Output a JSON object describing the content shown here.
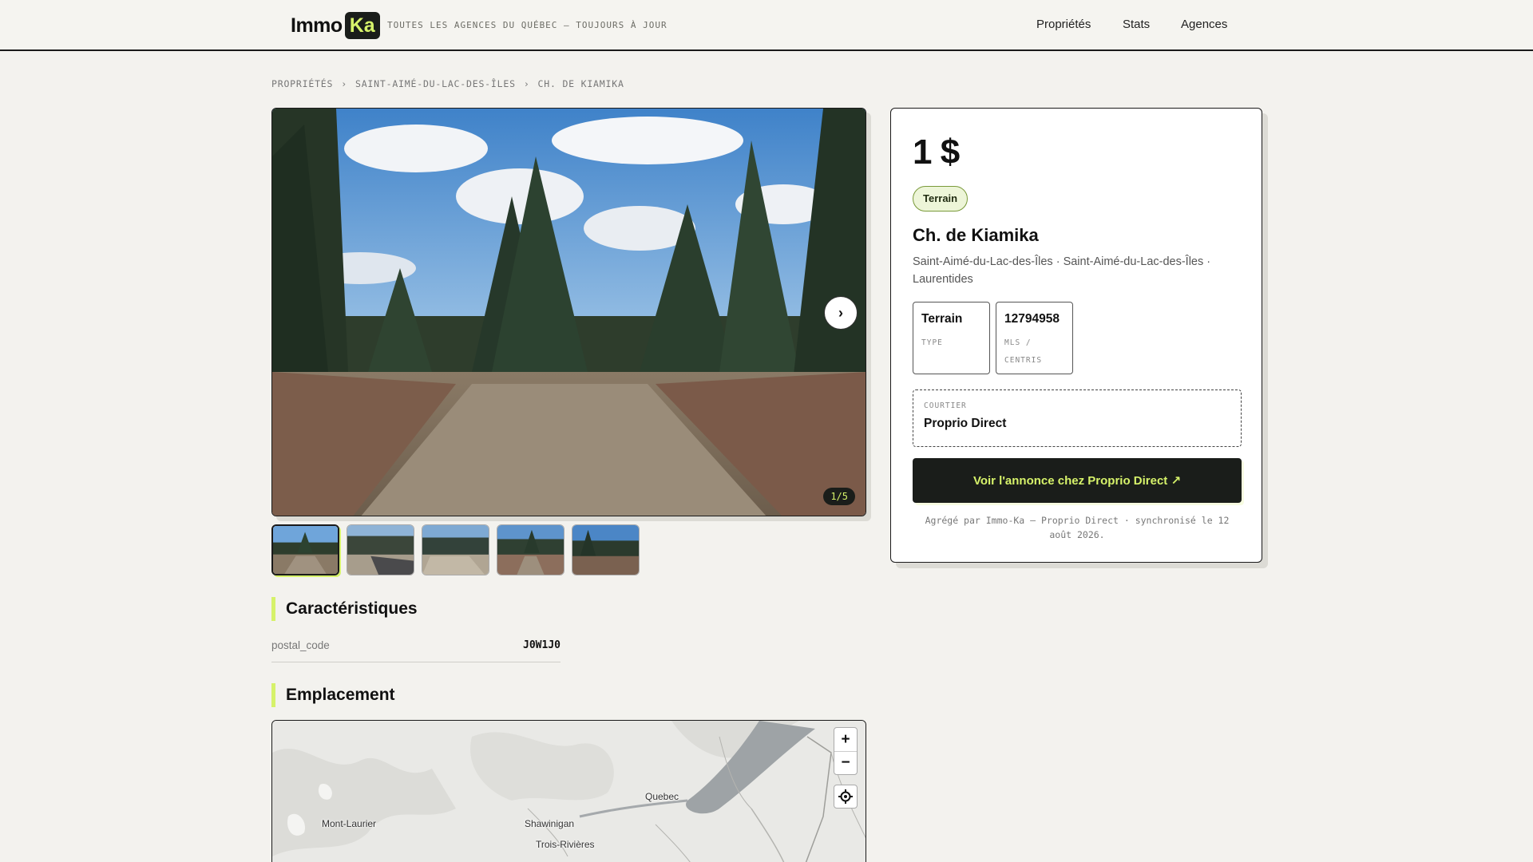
{
  "header": {
    "logo_text": "Immo",
    "logo_badge": "Ka",
    "tagline": "TOUTES LES AGENCES DU QUÉBEC — TOUJOURS À JOUR",
    "nav": [
      "Propriétés",
      "Stats",
      "Agences"
    ]
  },
  "breadcrumb": {
    "items": [
      "PROPRIÉTÉS",
      "SAINT-AIMÉ-DU-LAC-DES-ÎLES",
      "CH. DE KIAMIKA"
    ],
    "separator": "›"
  },
  "gallery": {
    "counter": "1/5",
    "next_icon": "›",
    "thumbnail_count": 5,
    "active_index": 0
  },
  "characteristics": {
    "title": "Caractéristiques",
    "rows": [
      {
        "key": "postal_code",
        "value": "J0W1J0"
      }
    ]
  },
  "location": {
    "title": "Emplacement",
    "zoom_in": "+",
    "zoom_out": "−",
    "cities": [
      "Mont-Laurier",
      "Shawinigan",
      "Trois-Rivières",
      "Quebec"
    ]
  },
  "listing": {
    "price": "1 $",
    "badge": "Terrain",
    "title": "Ch. de Kiamika",
    "location": "Saint-Aimé-du-Lac-des-Îles · Saint-Aimé-du-Lac-des-Îles · Laurentides",
    "stats": [
      {
        "value": "Terrain",
        "label": "TYPE"
      },
      {
        "value": "12794958",
        "label": "MLS / CENTRIS"
      }
    ],
    "broker_label": "COURTIER",
    "broker_name": "Proprio Direct",
    "cta": "Voir l'annonce chez Proprio Direct ↗",
    "footnote": "Agrégé par Immo-Ka — Proprio Direct · synchronisé le 12 août 2026."
  },
  "colors": {
    "accent": "#d6f26a",
    "dark": "#1a1d1a",
    "background": "#f3f2ee"
  }
}
